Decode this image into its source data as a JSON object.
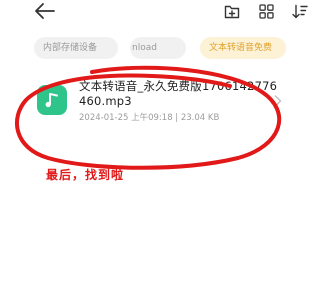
{
  "toolbar": {
    "back_icon": "arrow-left-icon",
    "new_folder_icon": "folder-plus-icon",
    "grid_view_icon": "grid-icon",
    "sort_icon": "sort-icon"
  },
  "breadcrumb": {
    "items": [
      {
        "label": "内部存储设备"
      },
      {
        "label": "nload"
      },
      {
        "label": "文本转语音免费"
      }
    ],
    "active_color": "#e0a32c"
  },
  "file": {
    "name": "文本转语音_永久免费版1706142776460.mp3",
    "meta": "2024-01-25 上午09:18 | 23.04 KB",
    "icon": "music-note-icon",
    "icon_color": "#2fc48a"
  },
  "annotation": {
    "text": "最后，找到啦",
    "color": "#e11919"
  }
}
